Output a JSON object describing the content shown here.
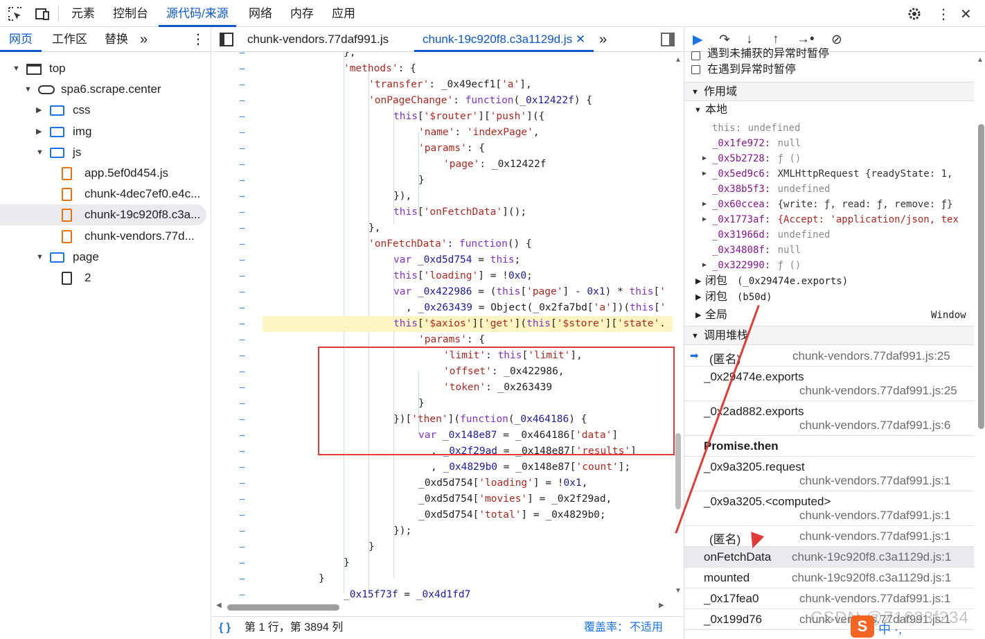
{
  "topbar": {
    "tabs": [
      "元素",
      "控制台",
      "源代码/来源",
      "网络",
      "内存",
      "应用"
    ],
    "active_tab": "源代码/来源",
    "settings_icon": "gear-icon",
    "more_icon": "kebab-icon",
    "close_icon": "close-icon"
  },
  "left": {
    "subtabs": [
      "网页",
      "工作区",
      "替换"
    ],
    "more": "»",
    "tree": [
      {
        "label": "top",
        "type": "frame",
        "depth": 0,
        "expanded": true
      },
      {
        "label": "spa6.scrape.center",
        "type": "cloud",
        "depth": 1,
        "expanded": true
      },
      {
        "label": "css",
        "type": "folder",
        "depth": 2,
        "expanded": false
      },
      {
        "label": "img",
        "type": "folder",
        "depth": 2,
        "expanded": false
      },
      {
        "label": "js",
        "type": "folder",
        "depth": 2,
        "expanded": true
      },
      {
        "label": "app.5ef0d454.js",
        "type": "file",
        "depth": 3
      },
      {
        "label": "chunk-4dec7ef0.e4c...",
        "type": "file",
        "depth": 3
      },
      {
        "label": "chunk-19c920f8.c3a...",
        "type": "file",
        "depth": 3,
        "selected": true
      },
      {
        "label": "chunk-vendors.77d...",
        "type": "file",
        "depth": 3
      },
      {
        "label": "page",
        "type": "folder",
        "depth": 2,
        "expanded": true
      },
      {
        "label": "2",
        "type": "doc",
        "depth": 3
      }
    ]
  },
  "editor": {
    "tabs": [
      "chunk-vendors.77daf991.js",
      "chunk-19c920f8.c3a1129d.js"
    ],
    "active_tab": "chunk-19c920f8.c3a1129d.js",
    "status_position": "第 1 行，第 3894 列",
    "status_coverage_label": "覆盖率：",
    "status_coverage_value": "不适用"
  },
  "right": {
    "pause_uncaught": "遇到未捕获的异常时暂停",
    "pause_caught": "在遇到异常时暂停",
    "scope_title": "作用域",
    "local_title": "本地",
    "closure1": "闭包",
    "closure1_val": "(_0x29474e.exports)",
    "closure2": "闭包",
    "closure2_val": "(b50d)",
    "global": "全局",
    "global_val": "Window",
    "callstack_title": "调用堆栈",
    "stack": [
      {
        "fn": "(匿名)",
        "loc": "chunk-vendors.77daf991.js:25"
      },
      {
        "fn": "_0x29474e.exports",
        "loc": "chunk-vendors.77daf991.js:25"
      },
      {
        "fn": "_0x2ad882.exports",
        "loc": "chunk-vendors.77daf991.js:6"
      },
      {
        "fn": "Promise.then",
        "loc": ""
      },
      {
        "fn": "_0x9a3205.request",
        "loc": "chunk-vendors.77daf991.js:1"
      },
      {
        "fn": "_0x9a3205.<computed>",
        "loc": "chunk-vendors.77daf991.js:1"
      },
      {
        "fn": "(匿名)",
        "loc": "chunk-vendors.77daf991.js:1"
      },
      {
        "fn": "onFetchData",
        "loc": "chunk-19c920f8.c3a1129d.js:1"
      },
      {
        "fn": "mounted",
        "loc": "chunk-19c920f8.c3a1129d.js:1"
      },
      {
        "fn": "_0x17fea0",
        "loc": "chunk-vendors.77daf991.js:1"
      },
      {
        "fn": "_0x199d76",
        "loc": "chunk-vendors.77daf991.js:1"
      }
    ]
  },
  "watermark": "CSDN @Z1623f234",
  "ime_label": "S",
  "ime_bar": "中 ·,"
}
